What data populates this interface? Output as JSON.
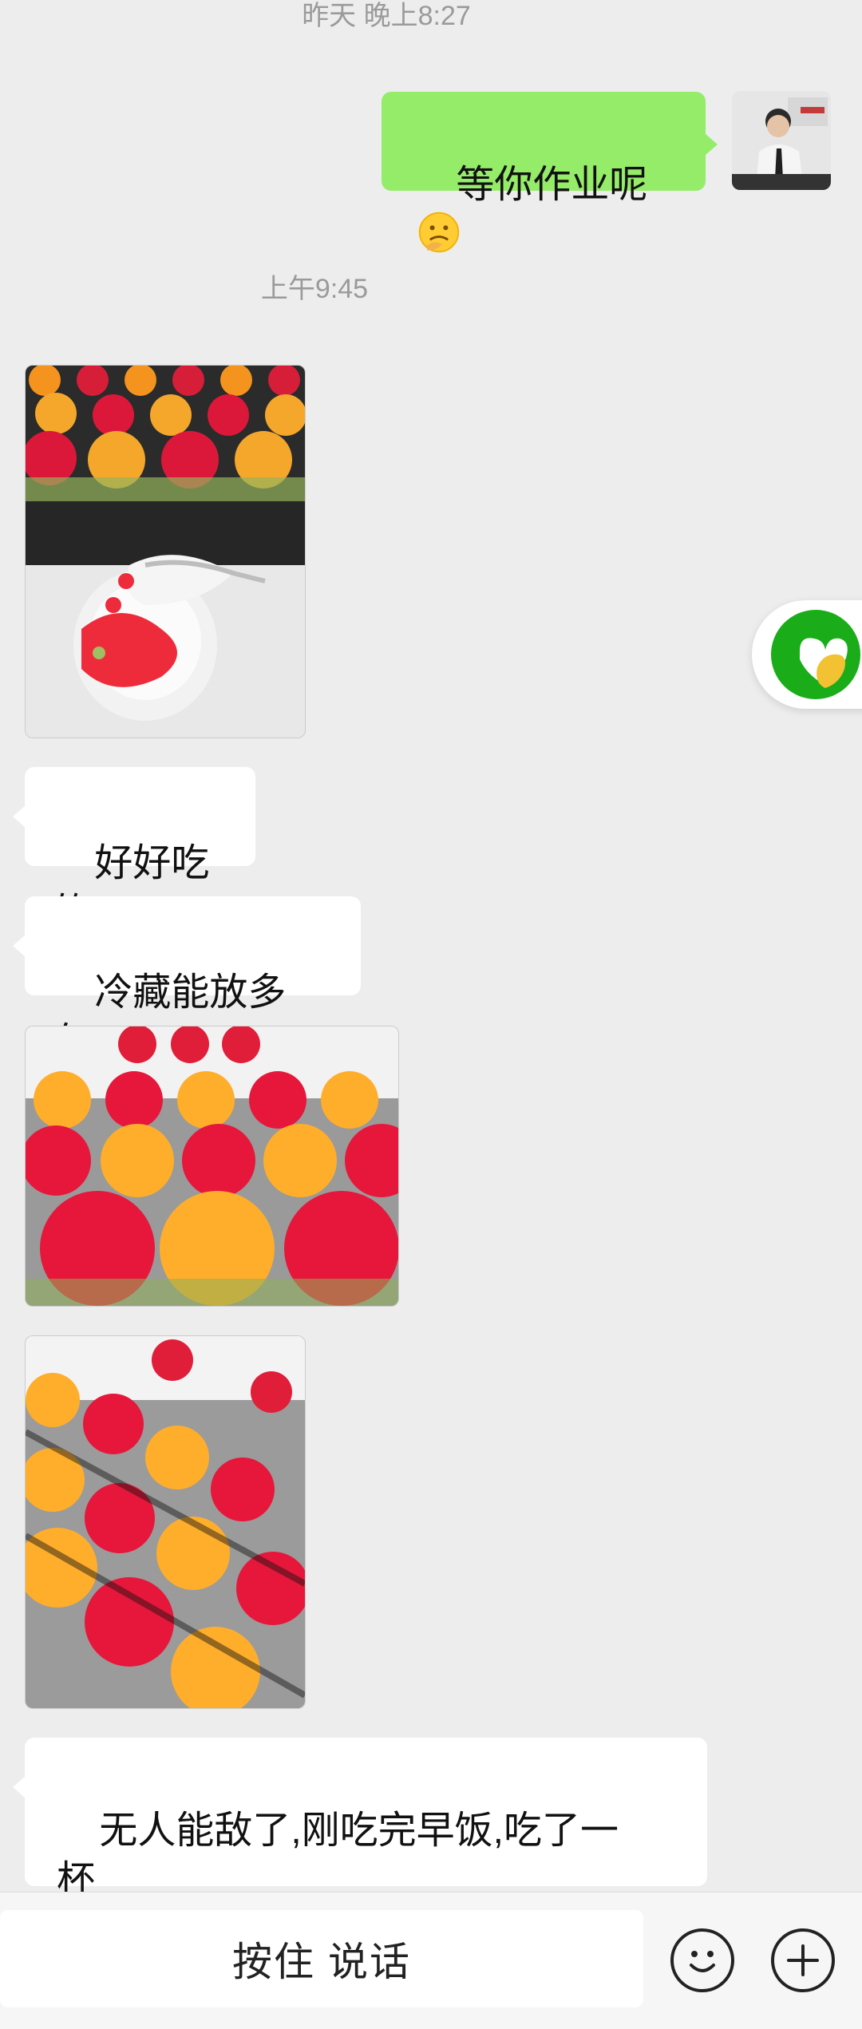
{
  "messages": {
    "ts_top": "昨天 晚上8:27",
    "ts_mid": "上午9:45",
    "out_1": "等你作业呢",
    "in_1": "好好吃的",
    "in_2": "冷藏能放多久?",
    "in_3": "无人能敌了,刚吃完早饭,吃了一\n杯"
  },
  "bottom": {
    "voice_label": "按住 说话"
  },
  "colors": {
    "bg": "#ededed",
    "outgoing_bubble": "#95ec69",
    "incoming_bubble": "#ffffff",
    "float_green": "#1aad19"
  },
  "icons": {
    "emoji_button": "smiley-icon",
    "plus_button": "plus-icon",
    "floating": "heart-app-icon"
  }
}
